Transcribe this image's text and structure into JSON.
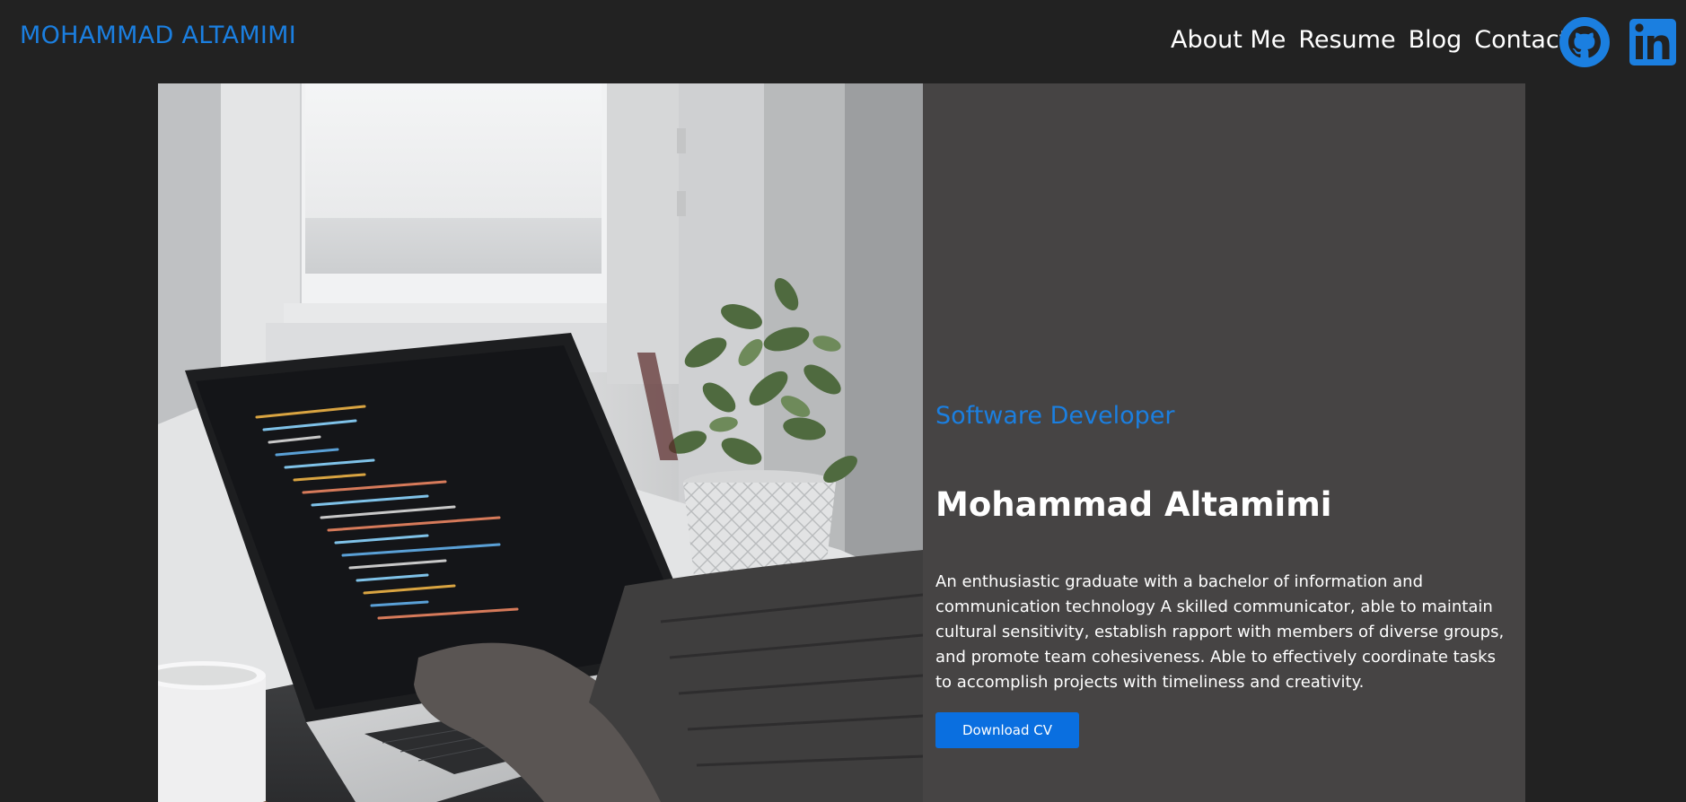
{
  "header": {
    "brand": "MOHAMMAD ALTAMIMI",
    "nav": [
      "About Me",
      "Resume",
      "Blog",
      "Contact"
    ],
    "social": [
      {
        "name": "github",
        "icon": "github-icon",
        "color": "#1b7fe0"
      },
      {
        "name": "linkedin",
        "icon": "linkedin-icon",
        "color": "#1b7fe0"
      }
    ]
  },
  "hero": {
    "image": {
      "icon": "laptop-desk-photo"
    },
    "subtitle": "Software Developer",
    "name": "Mohammad Altamimi",
    "bio": "An enthusiastic graduate with a bachelor of information and communication technology A skilled communicator, able to maintain cultural sensitivity, establish rapport with members of diverse groups, and promote team cohesiveness. Able to effectively coordinate tasks to accomplish projects with timeliness and creativity.",
    "cta_label": "Download CV"
  },
  "colors": {
    "background": "#222222",
    "panel": "#464444",
    "accent": "#1b7fe0",
    "button": "#0a6fe0",
    "text": "#ffffff"
  }
}
